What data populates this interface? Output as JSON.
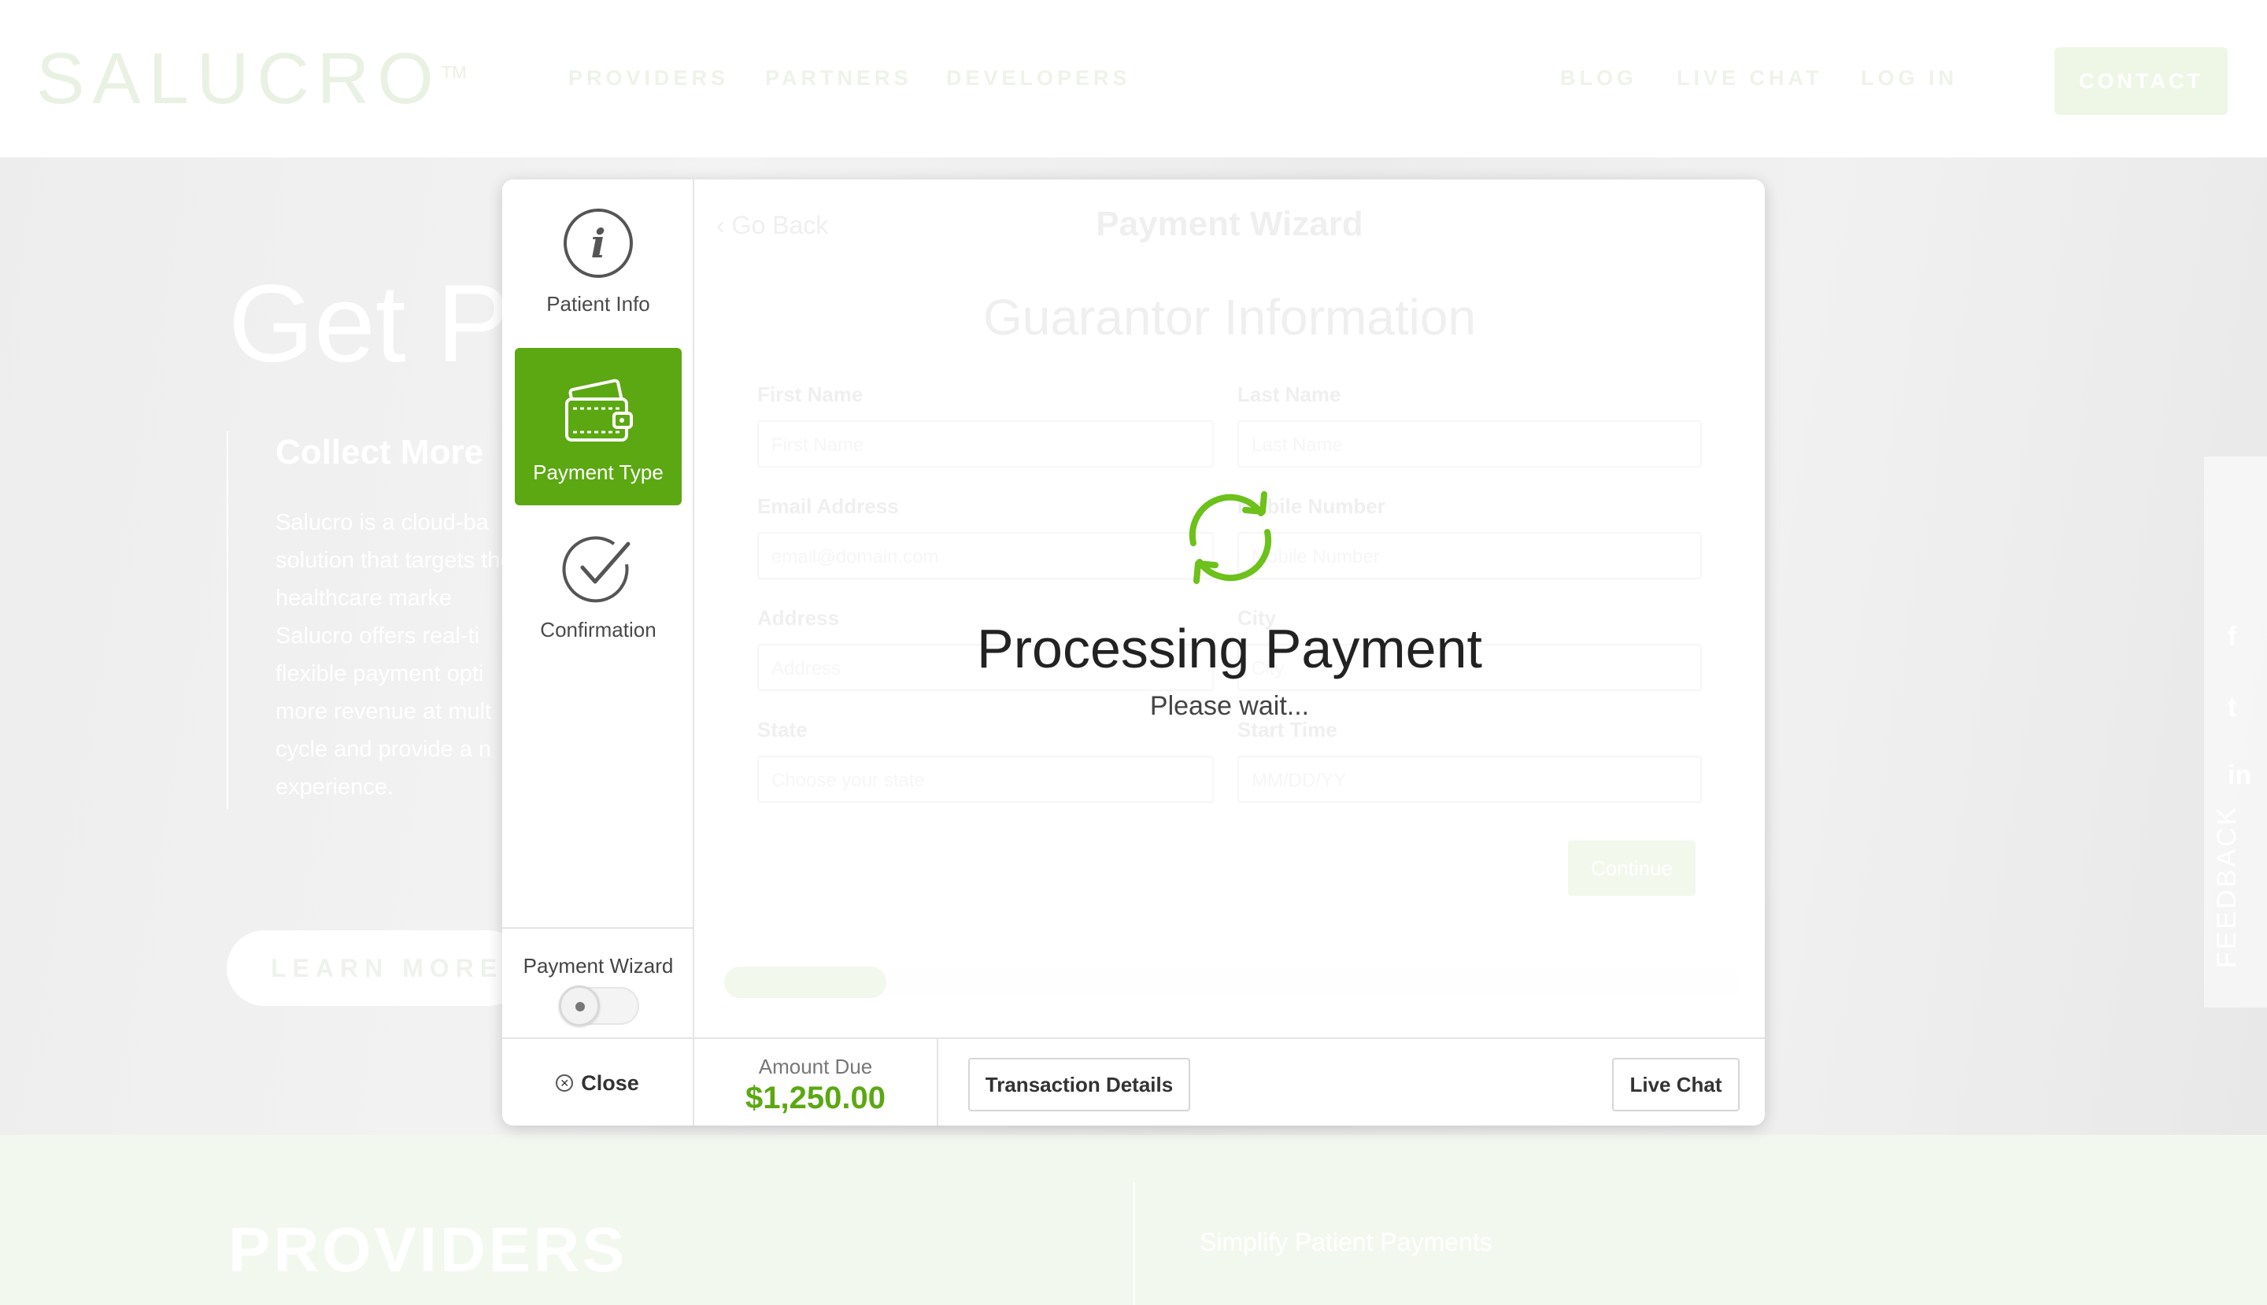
{
  "site": {
    "logo": "SALUCRO",
    "logo_tm": "TM",
    "nav_left": [
      "PROVIDERS",
      "PARTNERS",
      "DEVELOPERS"
    ],
    "nav_right": [
      "BLOG",
      "LIVE CHAT",
      "LOG IN"
    ],
    "contact": "CONTACT",
    "hero_title": "Get Pa",
    "hero_sub": "Collect More",
    "hero_text": "Salucro is a cloud-ba solution that targets the healthcare marke Salucro offers real-ti flexible payment opti more revenue at mult cycle and provide a n experience.",
    "learn_more": "LEARN MORE",
    "feedback": "FEEDBACK",
    "providers_title": "PROVIDERS",
    "providers_text": "Simplify Patient Payments"
  },
  "wizard": {
    "steps": [
      {
        "label": "Patient Info",
        "icon": "info-icon",
        "active": false
      },
      {
        "label": "Payment Type",
        "icon": "wallet-icon",
        "active": true
      },
      {
        "label": "Confirmation",
        "icon": "check-circle-icon",
        "active": false
      }
    ],
    "toggle_label": "Payment Wizard",
    "go_back": "Go Back",
    "title": "Payment Wizard",
    "section_title": "Guarantor Information",
    "fields": [
      {
        "label": "First Name",
        "placeholder": "First Name"
      },
      {
        "label": "Last Name",
        "placeholder": "Last Name"
      },
      {
        "label": "Email Address",
        "placeholder": "email@domain.com"
      },
      {
        "label": "Mobile Number",
        "placeholder": "Mobile Number"
      },
      {
        "label": "Address",
        "placeholder": "Address"
      },
      {
        "label": "City",
        "placeholder": "City"
      },
      {
        "label": "State",
        "placeholder": "Choose your state"
      },
      {
        "label": "Start Time",
        "placeholder": "MM/DD/YY"
      }
    ],
    "continue": "Continue",
    "progress": 0.16
  },
  "processing": {
    "title": "Processing Payment",
    "subtitle": "Please wait...",
    "icon": "refresh-icon"
  },
  "footer": {
    "close": "Close",
    "amount_label": "Amount Due",
    "amount_value": "$1,250.00",
    "transaction_details": "Transaction Details",
    "live_chat": "Live Chat"
  },
  "colors": {
    "accent": "#5ba812",
    "spinner": "#6cc11a"
  }
}
